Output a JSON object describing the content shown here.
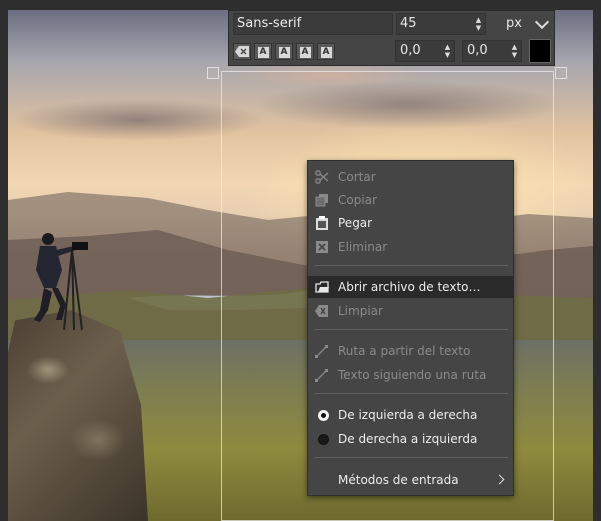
{
  "toolbar": {
    "font": "Sans-serif",
    "size": "45",
    "unit": "px",
    "style_buttons": [
      "A",
      "A",
      "A",
      "A"
    ],
    "indent": "0,0",
    "line_spacing": "0,0",
    "text_color": "#000000"
  },
  "context_menu": {
    "items": [
      {
        "label": "Cortar",
        "icon": "scissors-icon",
        "enabled": false
      },
      {
        "label": "Copiar",
        "icon": "copy-icon",
        "enabled": false
      },
      {
        "label": "Pegar",
        "icon": "paste-icon",
        "enabled": true
      },
      {
        "label": "Eliminar",
        "icon": "delete-icon",
        "enabled": false
      },
      {
        "label": "Abrir archivo de texto…",
        "icon": "open-file-icon",
        "enabled": true,
        "highlighted": true
      },
      {
        "label": "Limpiar",
        "icon": "clear-icon",
        "enabled": false
      },
      {
        "label": "Ruta a partir del texto",
        "icon": "path-from-text-icon",
        "enabled": false
      },
      {
        "label": "Texto siguiendo una ruta",
        "icon": "text-along-path-icon",
        "enabled": false
      },
      {
        "label": "De izquierda a derecha",
        "icon": "radio-selected",
        "enabled": true,
        "selected": true
      },
      {
        "label": "De derecha a izquierda",
        "icon": "radio-unselected",
        "enabled": true,
        "selected": false
      },
      {
        "label": "Métodos de entrada",
        "icon": "submenu-arrow-icon",
        "enabled": true
      }
    ]
  }
}
